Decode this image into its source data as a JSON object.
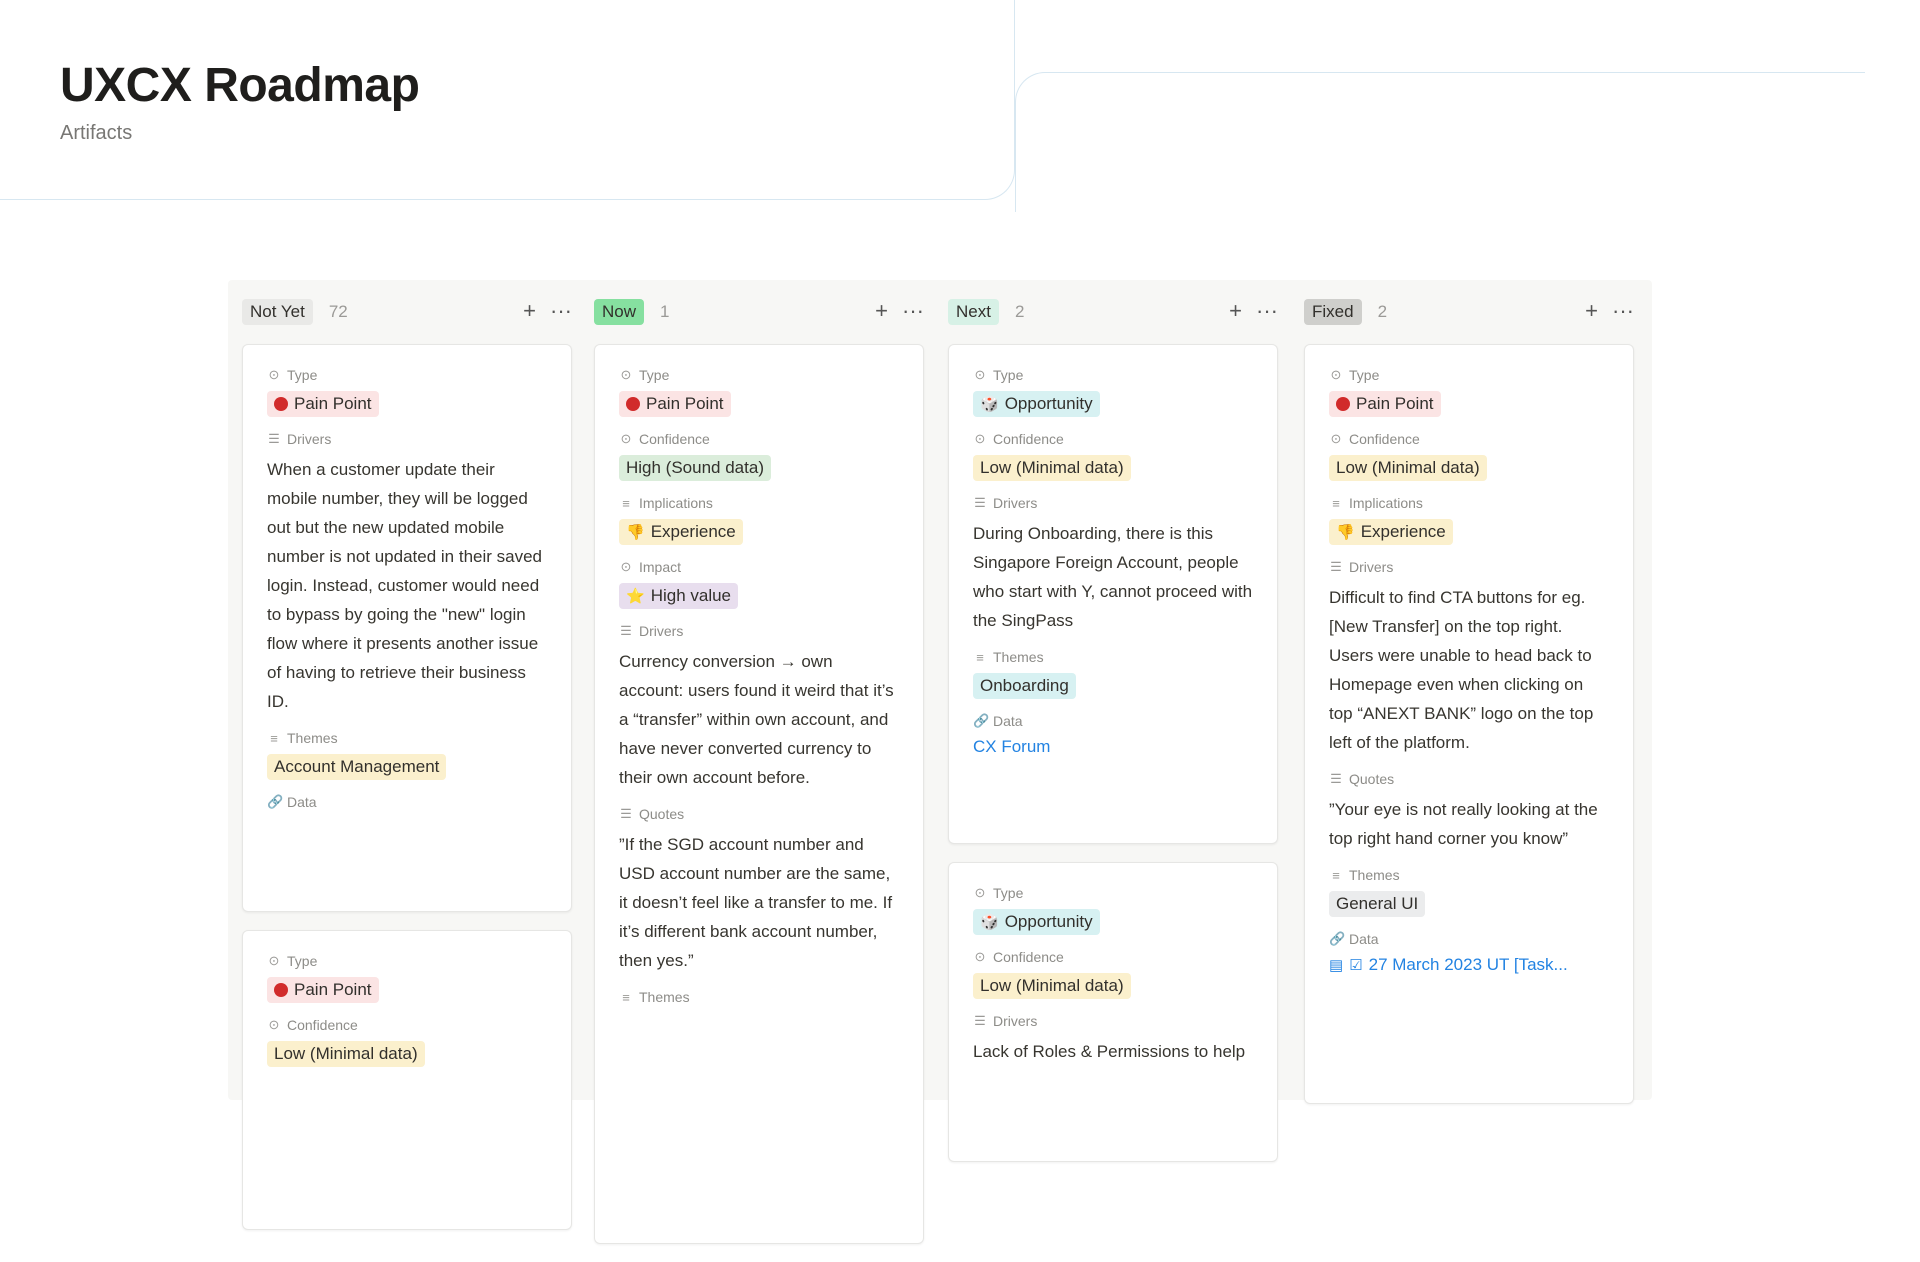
{
  "header": {
    "title": "UXCX Roadmap",
    "subtitle": "Artifacts"
  },
  "board": {
    "columns": [
      {
        "label": "Not Yet",
        "count": "72"
      },
      {
        "label": "Now",
        "count": "1"
      },
      {
        "label": "Next",
        "count": "2"
      },
      {
        "label": "Fixed",
        "count": "2"
      }
    ],
    "actions": {
      "add": "+",
      "more": "···"
    }
  },
  "props": {
    "type": "Type",
    "drivers": "Drivers",
    "themes": "Themes",
    "data": "Data",
    "confidence": "Confidence",
    "implications": "Implications",
    "impact": "Impact",
    "quotes": "Quotes"
  },
  "tags": {
    "pain_point": "Pain Point",
    "opportunity": "Opportunity",
    "high_sound": "High (Sound data)",
    "low_minimal": "Low (Minimal data)",
    "experience": "Experience",
    "high_value": "High value",
    "account_mgmt": "Account Management",
    "onboarding": "Onboarding",
    "general_ui": "General UI"
  },
  "cards": {
    "notyet1": {
      "drivers": "When a customer update their mobile number, they will be logged out but the new updated mobile number is not updated in their saved login. Instead, customer would need to bypass by going the \"new\" login flow where it presents another issue of having to retrieve their business ID."
    },
    "now1": {
      "drivers": "Currency conversion → own account: users found it weird that it’s a “transfer” within own account, and have never converted currency to their own account before.",
      "quotes": "”If the SGD account number and USD account number are the same, it doesn’t feel like a transfer to me. If it’s different bank account number, then yes.”"
    },
    "next1": {
      "drivers": "During Onboarding, there is this Singapore Foreign Account, people who start with Y, cannot proceed with the SingPass",
      "data": "CX Forum"
    },
    "next2": {
      "drivers": "Lack of Roles & Permissions to help"
    },
    "fixed1": {
      "drivers": "Difficult to find CTA buttons for eg. [New Transfer] on the top right. Users were unable to head back to Homepage even when clicking on top “ANEXT BANK” logo on the top left of the platform.",
      "quotes": "”Your eye is not really looking at the top right hand corner you know”",
      "data": "27 March 2023 UT [Task..."
    }
  },
  "colors": {
    "accent_link": "#2383e2",
    "pain_dot": "#d12b2b"
  }
}
